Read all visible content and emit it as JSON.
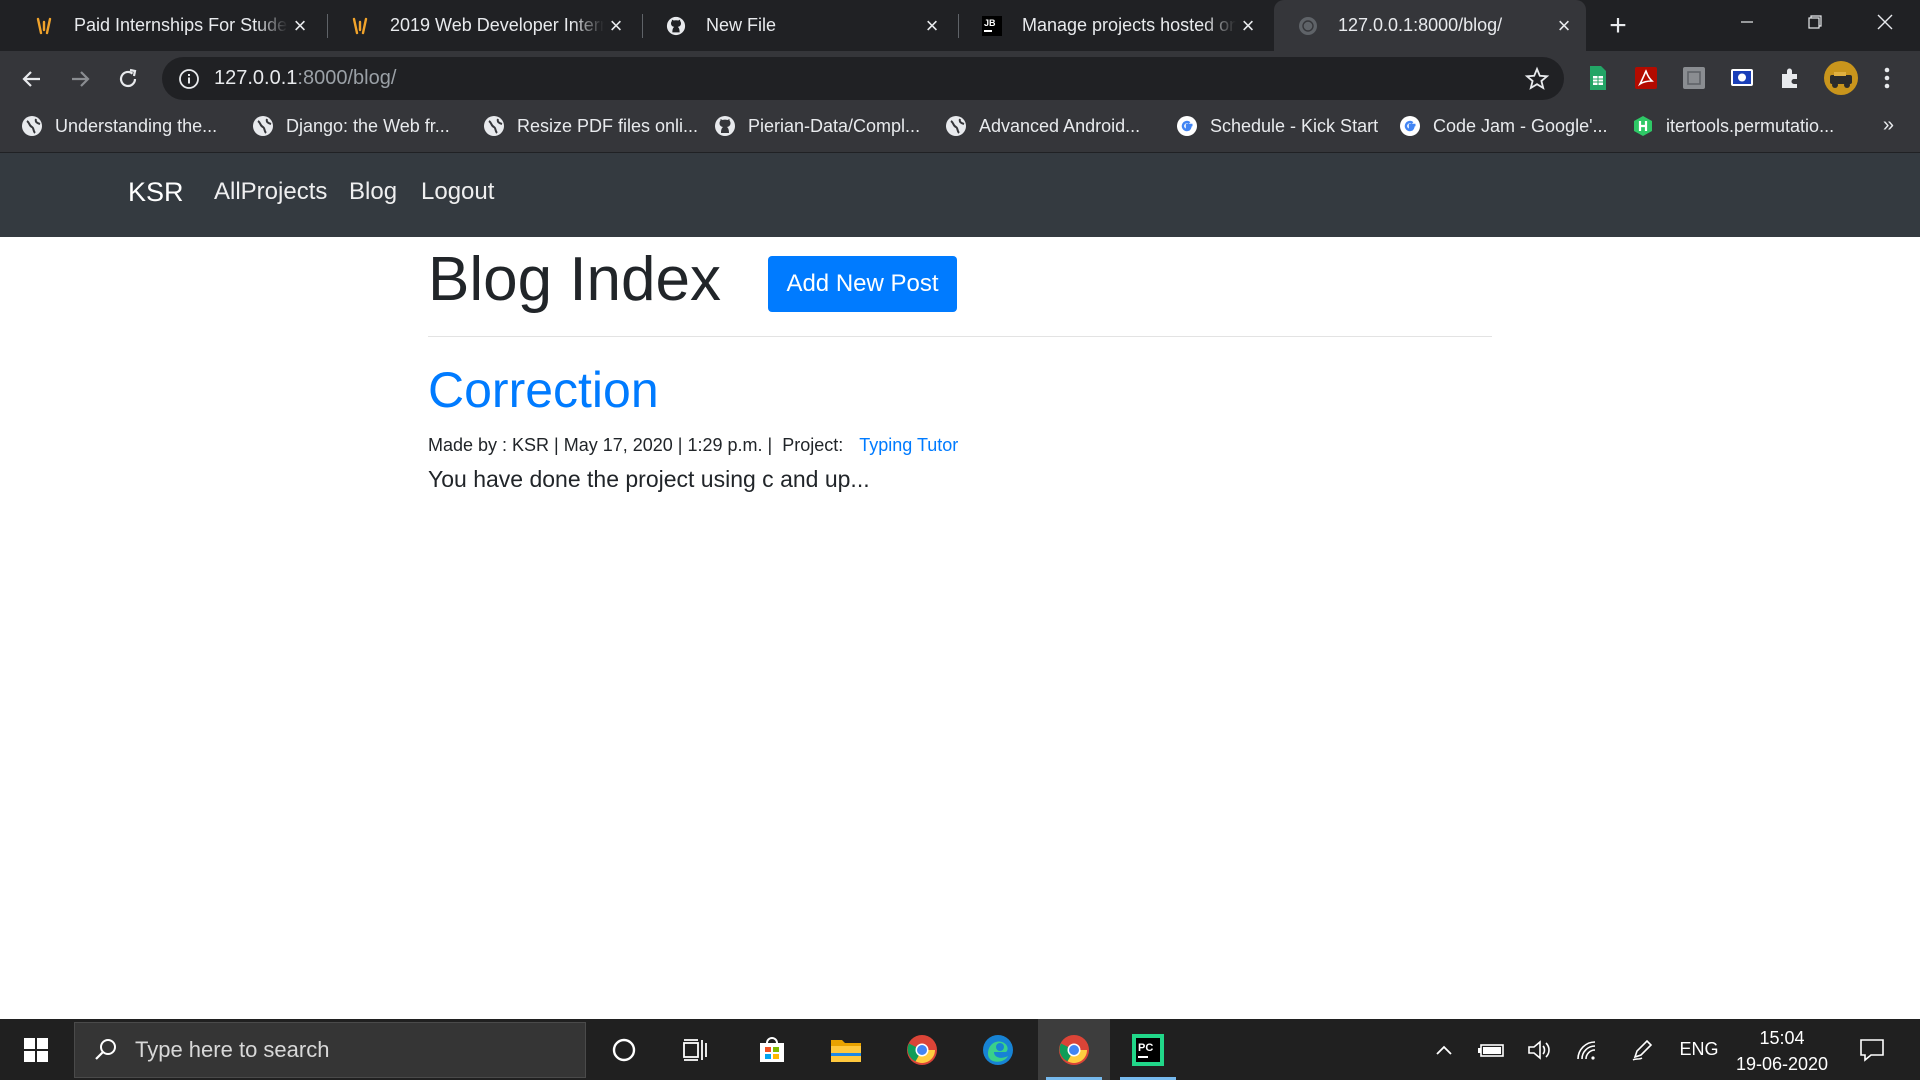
{
  "browser": {
    "tabs": [
      {
        "title": "Paid Internships For Students",
        "icon": "internshala-icon",
        "active": false
      },
      {
        "title": "2019 Web Developer Internship",
        "icon": "internshala-icon",
        "active": false
      },
      {
        "title": "New File",
        "icon": "github-icon",
        "active": false
      },
      {
        "title": "Manage projects hosted on",
        "icon": "jetbrains-icon",
        "active": false
      },
      {
        "title": "127.0.0.1:8000/blog/",
        "icon": "globe-icon",
        "active": true
      }
    ],
    "address": {
      "host": "127.0.0.1",
      "rest": ":8000/blog/"
    },
    "bookmarks": [
      {
        "label": "Understanding the...",
        "icon": "globe-icon"
      },
      {
        "label": "Django: the Web fr...",
        "icon": "globe-icon"
      },
      {
        "label": "Resize PDF files onli...",
        "icon": "globe-icon"
      },
      {
        "label": "Pierian-Data/Compl...",
        "icon": "github-icon"
      },
      {
        "label": "Advanced Android...",
        "icon": "globe-icon"
      },
      {
        "label": "Schedule - Kick Start",
        "icon": "google-icon"
      },
      {
        "label": "Code Jam - Google'...",
        "icon": "google-icon"
      },
      {
        "label": "itertools.permutatio...",
        "icon": "hackerrank-icon"
      }
    ],
    "bookmarks_more": "»"
  },
  "site": {
    "brand": "KSR",
    "nav": [
      "AllProjects",
      "Blog",
      "Logout"
    ],
    "heading": "Blog Index",
    "add_button": "Add New Post",
    "post": {
      "title": "Correction",
      "meta_prefix": "Made by : KSR | May 17, 2020 | 1:29 p.m. |  Project: ",
      "project_link": "Typing Tutor",
      "excerpt": "You have done the project using c and up..."
    }
  },
  "taskbar": {
    "search_placeholder": "Type here to search",
    "language": "ENG",
    "time": "15:04",
    "date": "19-06-2020"
  },
  "colors": {
    "accent": "#007bff",
    "navbar": "#343a40",
    "chrome_dark": "#202124",
    "chrome_toolbar": "#35363a",
    "taskbar": "#202020"
  }
}
